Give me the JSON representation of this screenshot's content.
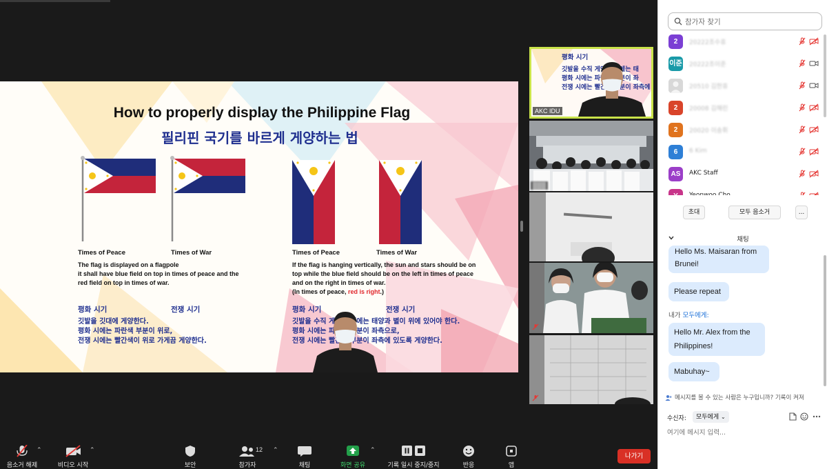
{
  "slide": {
    "title_en": "How to properly display the Philippine Flag",
    "title_ko": "필리핀 국기를 바르게 게양하는 법",
    "left": {
      "cap_peace": "Times of Peace",
      "cap_war": "Times of War",
      "desc_lines": [
        "The flag is displayed on a flagpole",
        "it shall have blue field on top in times of peace and the",
        "red field on top in times of war."
      ],
      "ko_peace": "평화 시기",
      "ko_war": "전쟁 시기",
      "ko_lines": [
        "깃발을 깃대에 게양한다.",
        "평화 시에는 파란색 부분이 위로,",
        "전쟁 시에는 빨간색이 위로 가게끔 게양한다."
      ]
    },
    "right": {
      "cap_peace": "Times of Peace",
      "cap_war": "Times of War",
      "desc_lines": [
        "If the flag is hanging vertically, the sun and stars should be on",
        "top while the blue field should be on the left in times of peace",
        "and on the right in times of war."
      ],
      "desc_last_prefix": "(In times of peace, ",
      "desc_last_red": "red is right",
      "desc_last_suffix": ".)",
      "ko_peace": "평화 시기",
      "ko_war": "전쟁 시기",
      "ko_lines": [
        "깃발을 수직 게양할 때에는 태양과 별이 위에 있어야 한다.",
        "평화 시에는 파란색 부분이 좌측으로,",
        "전쟁 시에는 빨간색 부분이 좌측에 있도록 게양한다."
      ]
    }
  },
  "video_strip": {
    "tile1": {
      "name": "AKC IDU",
      "lines": [
        "평화 시기",
        "깃발을 수직 게양할 때에는 태",
        "평화 시에는 파란색 부분이 좌",
        "전쟁 시에는 빨간색 부분이 좌측에"
      ]
    }
  },
  "participants": {
    "search_placeholder": "참가자 찾기",
    "rows": [
      {
        "avatar": "2",
        "name": "20222조수휴",
        "color": "#7b3fd4",
        "blurred": true
      },
      {
        "avatar": "이준",
        "name": "20222조이준",
        "color": "#1a9aa8",
        "blurred": true
      },
      {
        "avatar": "",
        "name": "20510 김한휴",
        "color": "#cccccc",
        "blurred": true
      },
      {
        "avatar": "2",
        "name": "20008 김해린",
        "color": "#d9442a",
        "blurred": true
      },
      {
        "avatar": "2",
        "name": "20020 이송휘",
        "color": "#e0731e",
        "blurred": true
      },
      {
        "avatar": "6",
        "name": "6 Kim",
        "color": "#2e7fd6",
        "blurred": true
      },
      {
        "avatar": "AS",
        "name": "AKC Staff",
        "color": "#9b3fc8",
        "blurred": false
      },
      {
        "avatar": "Y",
        "name": "Yeonwoo Cho",
        "color": "#c8358a",
        "blurred": false
      }
    ],
    "invite_label": "초대",
    "mute_all_label": "모두 음소거",
    "more_label": "..."
  },
  "chat": {
    "title": "채팅",
    "messages": [
      {
        "text_lines": [
          "Hello Ms. Maisaran from",
          "Brunei!"
        ]
      },
      {
        "text_lines": [
          "Please repeat"
        ]
      },
      {
        "text_lines": [
          "Hello Mr. Alex from the",
          "Philippines!"
        ]
      },
      {
        "text_lines": [
          "Mabuhay~"
        ]
      }
    ],
    "sender_prefix": "내가 ",
    "sender_to": "모두에게:",
    "who_can_see": "메시지를 볼 수 있는 사람은 누구입니까? 기록이 켜져",
    "recipient_label": "수신자:",
    "recipient_value": "모두에게",
    "input_placeholder": "여기에 메시지 입력..."
  },
  "toolbar": {
    "unmute": "음소거 해제",
    "start_video": "비디오 시작",
    "security": "보안",
    "participants": "참가자",
    "participants_count": "12",
    "chat": "채팅",
    "share_screen": "화면 공유",
    "record_pause": "기록 일시 중지/중지",
    "reactions": "반응",
    "apps": "앱",
    "leave": "나가기"
  },
  "colors": {
    "flag_blue": "#1f2d7a",
    "flag_red": "#c4243b",
    "flag_yellow": "#f5c518",
    "active_border": "#c9e34a",
    "leave_red": "#d93025",
    "chat_bubble": "#dcebfd",
    "share_green": "#23a04a"
  }
}
